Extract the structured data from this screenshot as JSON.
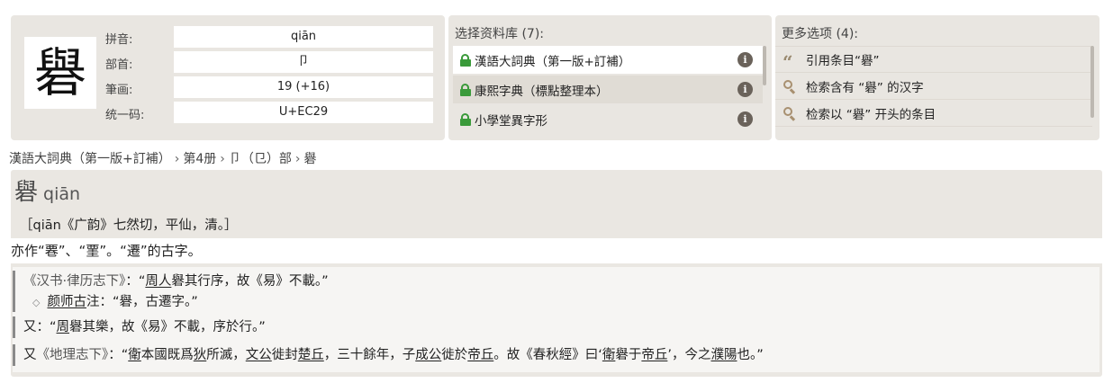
{
  "character": {
    "glyph": "礜",
    "fields": [
      {
        "label": "拼音:",
        "value": "qiān"
      },
      {
        "label": "部首:",
        "value": "卩"
      },
      {
        "label": "筆画:",
        "value": "19 (+16)"
      },
      {
        "label": "统一码:",
        "value": "U+EC29"
      }
    ]
  },
  "dictionaries": {
    "title": "选择资料库 (7):",
    "items": [
      {
        "name": "漢語大詞典（第一版+訂補）",
        "selected": true,
        "icon": "lock-open-icon"
      },
      {
        "name": "康熙字典（標點整理本）",
        "selected": false,
        "icon": "lock-open-icon"
      },
      {
        "name": "小學堂異字形",
        "selected": false,
        "icon": "lock-open-icon"
      }
    ],
    "info_icon_glyph": "i"
  },
  "more_options": {
    "title": "更多选项 (4):",
    "items": [
      {
        "icon": "quote-icon",
        "label": "引用条目“礜”"
      },
      {
        "icon": "search-icon",
        "label": "检索含有 “礜” 的汉字"
      },
      {
        "icon": "search-icon",
        "label": "检索以 “礜” 开头的条目"
      }
    ]
  },
  "breadcrumb": [
    "漢語大詞典（第一版+訂補）",
    "第4册",
    "卩（㔾）部",
    "礜"
  ],
  "entry": {
    "char": "礜",
    "pinyin": "qiān",
    "pronunciation": "［qiān《广韵》七然切，平仙，清。］",
    "definition": "亦作“䙴”、“䙵”。“遷”的古字。",
    "quotes": {
      "q1_source": "《汉书·律历志下》",
      "q1_text_a": "：“",
      "q1_name": "周人",
      "q1_text_b": "礜其行序，故《易》不載。”",
      "q1_note_name": "颜师古",
      "q1_note_text": "注：“礜，古遷字。”",
      "q2_text_a": "又：“",
      "q2_name": "周",
      "q2_text_b": "礜其樂，故《易》不載，序於行。”",
      "q3_text_a": "又",
      "q3_source": "《地理志下》",
      "q3_text_b": "：“",
      "q3_n1": "衛",
      "q3_t1": "本國既爲",
      "q3_n2": "狄",
      "q3_t2": "所滅，",
      "q3_n3": "文公",
      "q3_t3": "徙封",
      "q3_n4": "楚丘",
      "q3_t4": "，三十餘年，子",
      "q3_n5": "成公",
      "q3_t5": "徙於",
      "q3_n6": "帝丘",
      "q3_t6": "。故《春秋經》曰‘",
      "q3_n7": "衛",
      "q3_t7": "礜于",
      "q3_n8": "帝丘",
      "q3_t8": "’，今之",
      "q3_n9": "濮陽",
      "q3_t9": "也。”"
    }
  },
  "colors": {
    "panel_bg": "#e9e6e1",
    "lock_green": "#3a9a3a",
    "info_icon_bg": "#6a625a",
    "icon_tan": "#a89070"
  }
}
